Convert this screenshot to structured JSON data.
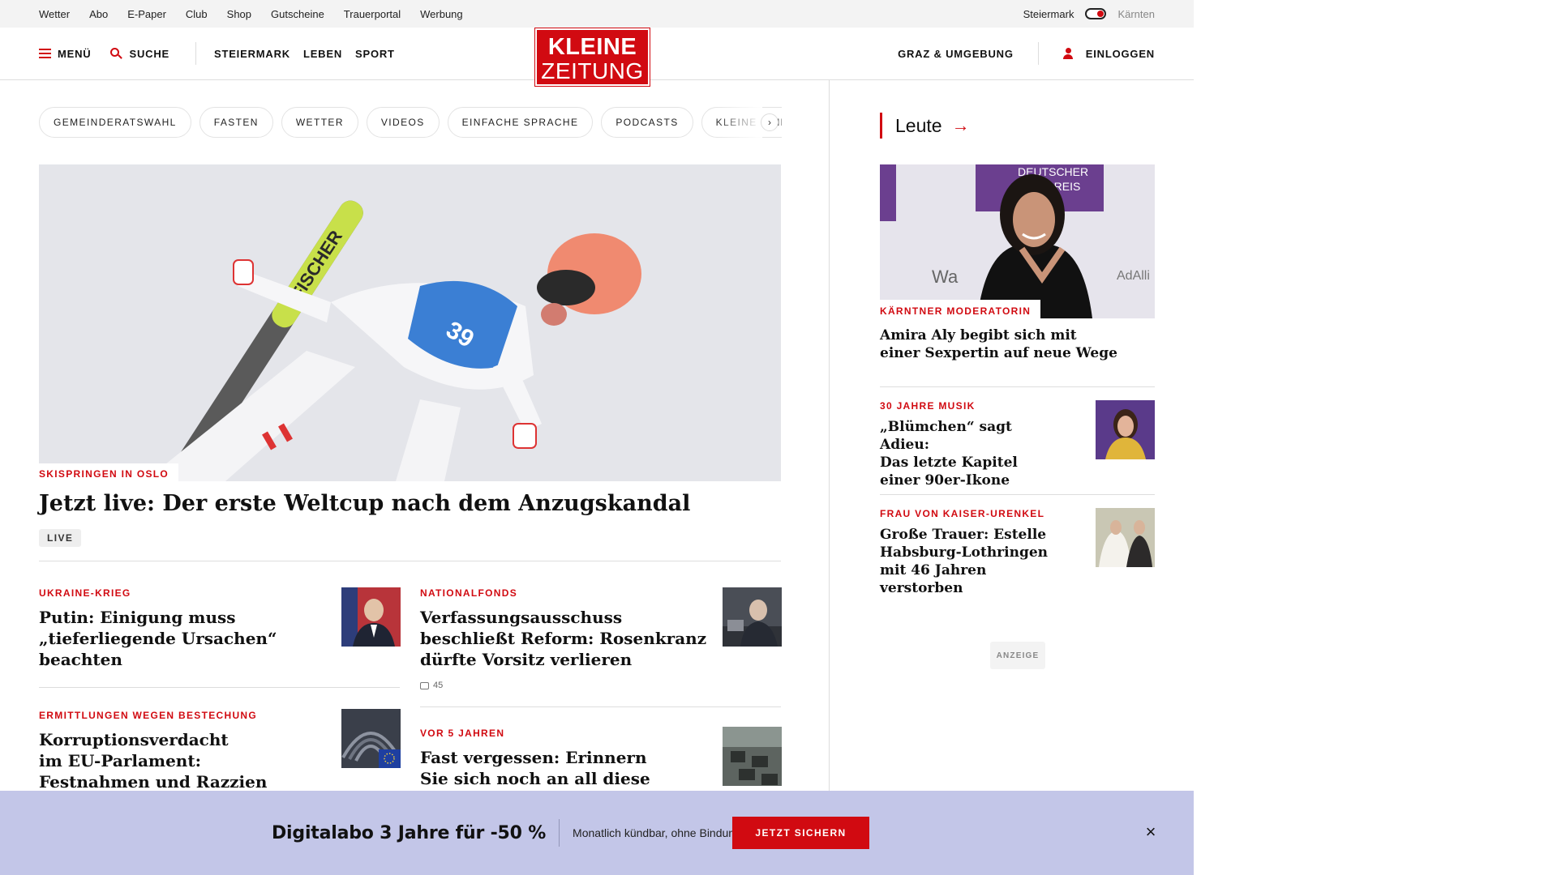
{
  "topbar": {
    "links": [
      "Wetter",
      "Abo",
      "E-Paper",
      "Club",
      "Shop",
      "Gutscheine",
      "Trauerportal",
      "Werbung"
    ],
    "region_left": "Steiermark",
    "region_right": "Kärnten"
  },
  "header": {
    "menu_label": "MENÜ",
    "search_label": "SUCHE",
    "nav": [
      "STEIERMARK",
      "LEBEN",
      "SPORT"
    ],
    "logo_line1": "KLEINE",
    "logo_line2": "ZEITUNG",
    "region_link": "GRAZ & UMGEBUNG",
    "login_label": "EINLOGGEN"
  },
  "chips": [
    "GEMEINDERATSWAHL",
    "FASTEN",
    "WETTER",
    "VIDEOS",
    "EINFACHE SPRACHE",
    "PODCASTS",
    "KLEINE KINDE"
  ],
  "hero": {
    "kicker": "SKISPRINGEN IN OSLO",
    "title": "Jetzt live: Der erste Weltcup nach dem Anzugskandal",
    "badge": "LIVE",
    "image_alt": "Skispringerin im Flug"
  },
  "teasers": [
    {
      "kicker": "UKRAINE-KRIEG",
      "title_lines": [
        "Putin: Einigung muss",
        "„tieferliegende Ursachen“ beachten"
      ]
    },
    {
      "kicker": "NATIONALFONDS",
      "title_lines": [
        "Verfassungsausschuss",
        "beschließt Reform: Rosenkranz",
        "dürfte Vorsitz verlieren"
      ],
      "comments": "45"
    },
    {
      "kicker": "ERMITTLUNGEN WEGEN BESTECHUNG",
      "title_lines": [
        "Korruptionsverdacht",
        "im EU-Parlament:",
        "Festnahmen und Razzien"
      ]
    },
    {
      "kicker": "VOR 5 JAHREN",
      "title_lines": [
        "Fast vergessen: Erinnern",
        "Sie sich noch an all diese"
      ]
    }
  ],
  "sidebar": {
    "section_title": "Leute",
    "main": {
      "kicker": "KÄRNTNER MODERATORIN",
      "title_lines": [
        "Amira Aly begibt sich mit",
        "einer Sexpertin auf neue Wege"
      ],
      "image_text_top": "DEUTSCHER",
      "image_text_mid": "FUMPREIS",
      "image_text_right": "AdAlli",
      "image_text_left": "Wa"
    },
    "items": [
      {
        "kicker": "30 JAHRE MUSIK",
        "title_lines": [
          "„Blümchen“ sagt Adieu:",
          "Das letzte Kapitel",
          "einer 90er-Ikone"
        ]
      },
      {
        "kicker": "FRAU VON KAISER-URENKEL",
        "title_lines": [
          "Große Trauer: Estelle",
          "Habsburg-Lothringen",
          "mit 46 Jahren verstorben"
        ]
      }
    ],
    "ad_label": "ANZEIGE"
  },
  "promo": {
    "headline": "Digitalabo 3 Jahre für -50 %",
    "sub": "Monatlich kündbar, ohne Bindung.",
    "cta": "JETZT SICHERN",
    "close": "×"
  },
  "colors": {
    "brand_red": "#d10a11",
    "promo_bg": "#c3c6e8",
    "topbar_bg": "#f3f3f3"
  }
}
